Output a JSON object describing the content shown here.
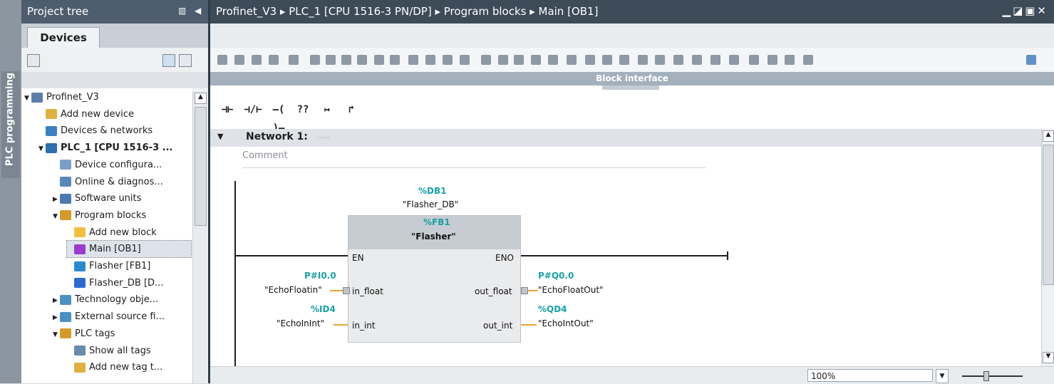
{
  "side_tab": {
    "label": "PLC programming"
  },
  "project_tree": {
    "title": "Project tree",
    "tab_devices": "Devices",
    "items": [
      {
        "label": "Profinet_V3",
        "level": 0,
        "twisty": "▼"
      },
      {
        "label": "Add new device",
        "level": 1,
        "twisty": ""
      },
      {
        "label": "Devices & networks",
        "level": 1,
        "twisty": ""
      },
      {
        "label": "PLC_1 [CPU 1516-3 ...",
        "level": 1,
        "twisty": "▼",
        "bold": true
      },
      {
        "label": "Device configura...",
        "level": 2,
        "twisty": ""
      },
      {
        "label": "Online & diagnos...",
        "level": 2,
        "twisty": ""
      },
      {
        "label": "Software units",
        "level": 2,
        "twisty": "▶"
      },
      {
        "label": "Program blocks",
        "level": 2,
        "twisty": "▼"
      },
      {
        "label": "Add new block",
        "level": 3,
        "twisty": ""
      },
      {
        "label": "Main [OB1]",
        "level": 3,
        "twisty": "",
        "selected": true
      },
      {
        "label": "Flasher [FB1]",
        "level": 3,
        "twisty": ""
      },
      {
        "label": "Flasher_DB [D...",
        "level": 3,
        "twisty": ""
      },
      {
        "label": "Technology obje...",
        "level": 2,
        "twisty": "▶"
      },
      {
        "label": "External source fi...",
        "level": 2,
        "twisty": "▶"
      },
      {
        "label": "PLC tags",
        "level": 2,
        "twisty": "▼"
      },
      {
        "label": "Show all tags",
        "level": 3,
        "twisty": ""
      },
      {
        "label": "Add new tag t...",
        "level": 3,
        "twisty": ""
      }
    ]
  },
  "editor": {
    "breadcrumb": "Profinet_V3  ▸  PLC_1 [CPU 1516-3 PN/DP]  ▸  Program blocks  ▸  Main [OB1]",
    "block_interface_label": "Block interface",
    "network_title": "Network 1:",
    "network_dots": ".....",
    "comment_placeholder": "Comment",
    "zoom_value": "100%"
  },
  "ladder_tools": [
    "⊣⊢",
    "⊣/⊢",
    "–( )–",
    "??",
    "↦",
    "↱"
  ],
  "fb_block": {
    "db_address": "%DB1",
    "db_name": "\"Flasher_DB\"",
    "fb_address": "%FB1",
    "fb_name": "\"Flasher\"",
    "pin_en": "EN",
    "pin_eno": "ENO",
    "in1_name": "in_float",
    "in1_addr": "P#I0.0",
    "in1_tag": "\"EchoFloatin\"",
    "in2_name": "in_int",
    "in2_addr": "%ID4",
    "in2_tag": "\"EchoInInt\"",
    "out1_name": "out_float",
    "out1_addr": "P#Q0.0",
    "out1_tag": "\"EchoFloatOut\"",
    "out2_name": "out_int",
    "out2_addr": "%QD4",
    "out2_tag": "\"EchoIntOut\""
  },
  "colors": {
    "accent_teal": "#19a0a8",
    "header_dark": "#3d4a58",
    "wire_orange": "#e8a52c"
  }
}
